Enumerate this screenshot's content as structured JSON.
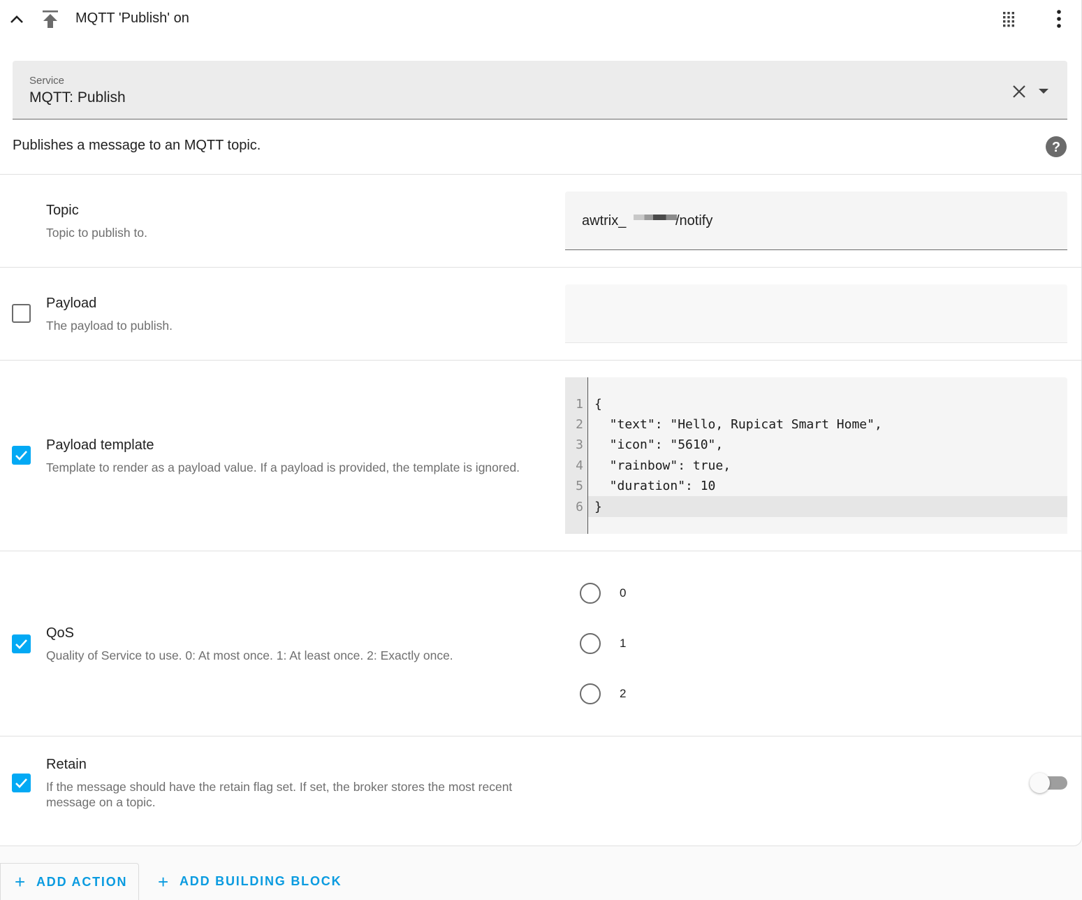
{
  "header": {
    "title": "MQTT 'Publish' on"
  },
  "service": {
    "label": "Service",
    "value": "MQTT: Publish"
  },
  "description": "Publishes a message to an MQTT topic.",
  "fields": {
    "topic": {
      "title": "Topic",
      "description": "Topic to publish to.",
      "value_prefix": "awtrix_",
      "value_suffix": "/notify"
    },
    "payload": {
      "title": "Payload",
      "description": "The payload to publish.",
      "checked": false
    },
    "payload_template": {
      "title": "Payload template",
      "description": "Template to render as a payload value. If a payload is provided, the template is ignored.",
      "checked": true,
      "line_numbers": [
        "1",
        "2",
        "3",
        "4",
        "5",
        "6"
      ],
      "code_lines": [
        "{",
        "  \"text\": \"Hello, Rupicat Smart Home\",",
        "  \"icon\": \"5610\",",
        "  \"rainbow\": true,",
        "  \"duration\": 10",
        "}"
      ]
    },
    "qos": {
      "title": "QoS",
      "description": "Quality of Service to use. 0: At most once. 1: At least once. 2: Exactly once.",
      "checked": true,
      "options": [
        "0",
        "1",
        "2"
      ]
    },
    "retain": {
      "title": "Retain",
      "description": "If the message should have the retain flag set. If set, the broker stores the most recent message on a topic.",
      "checked": true,
      "switch_on": false
    }
  },
  "footer": {
    "add_action": "ADD ACTION",
    "add_building_block": "ADD BUILDING BLOCK"
  },
  "colors": {
    "accent": "#03a9f4",
    "link": "#0a9be0"
  }
}
